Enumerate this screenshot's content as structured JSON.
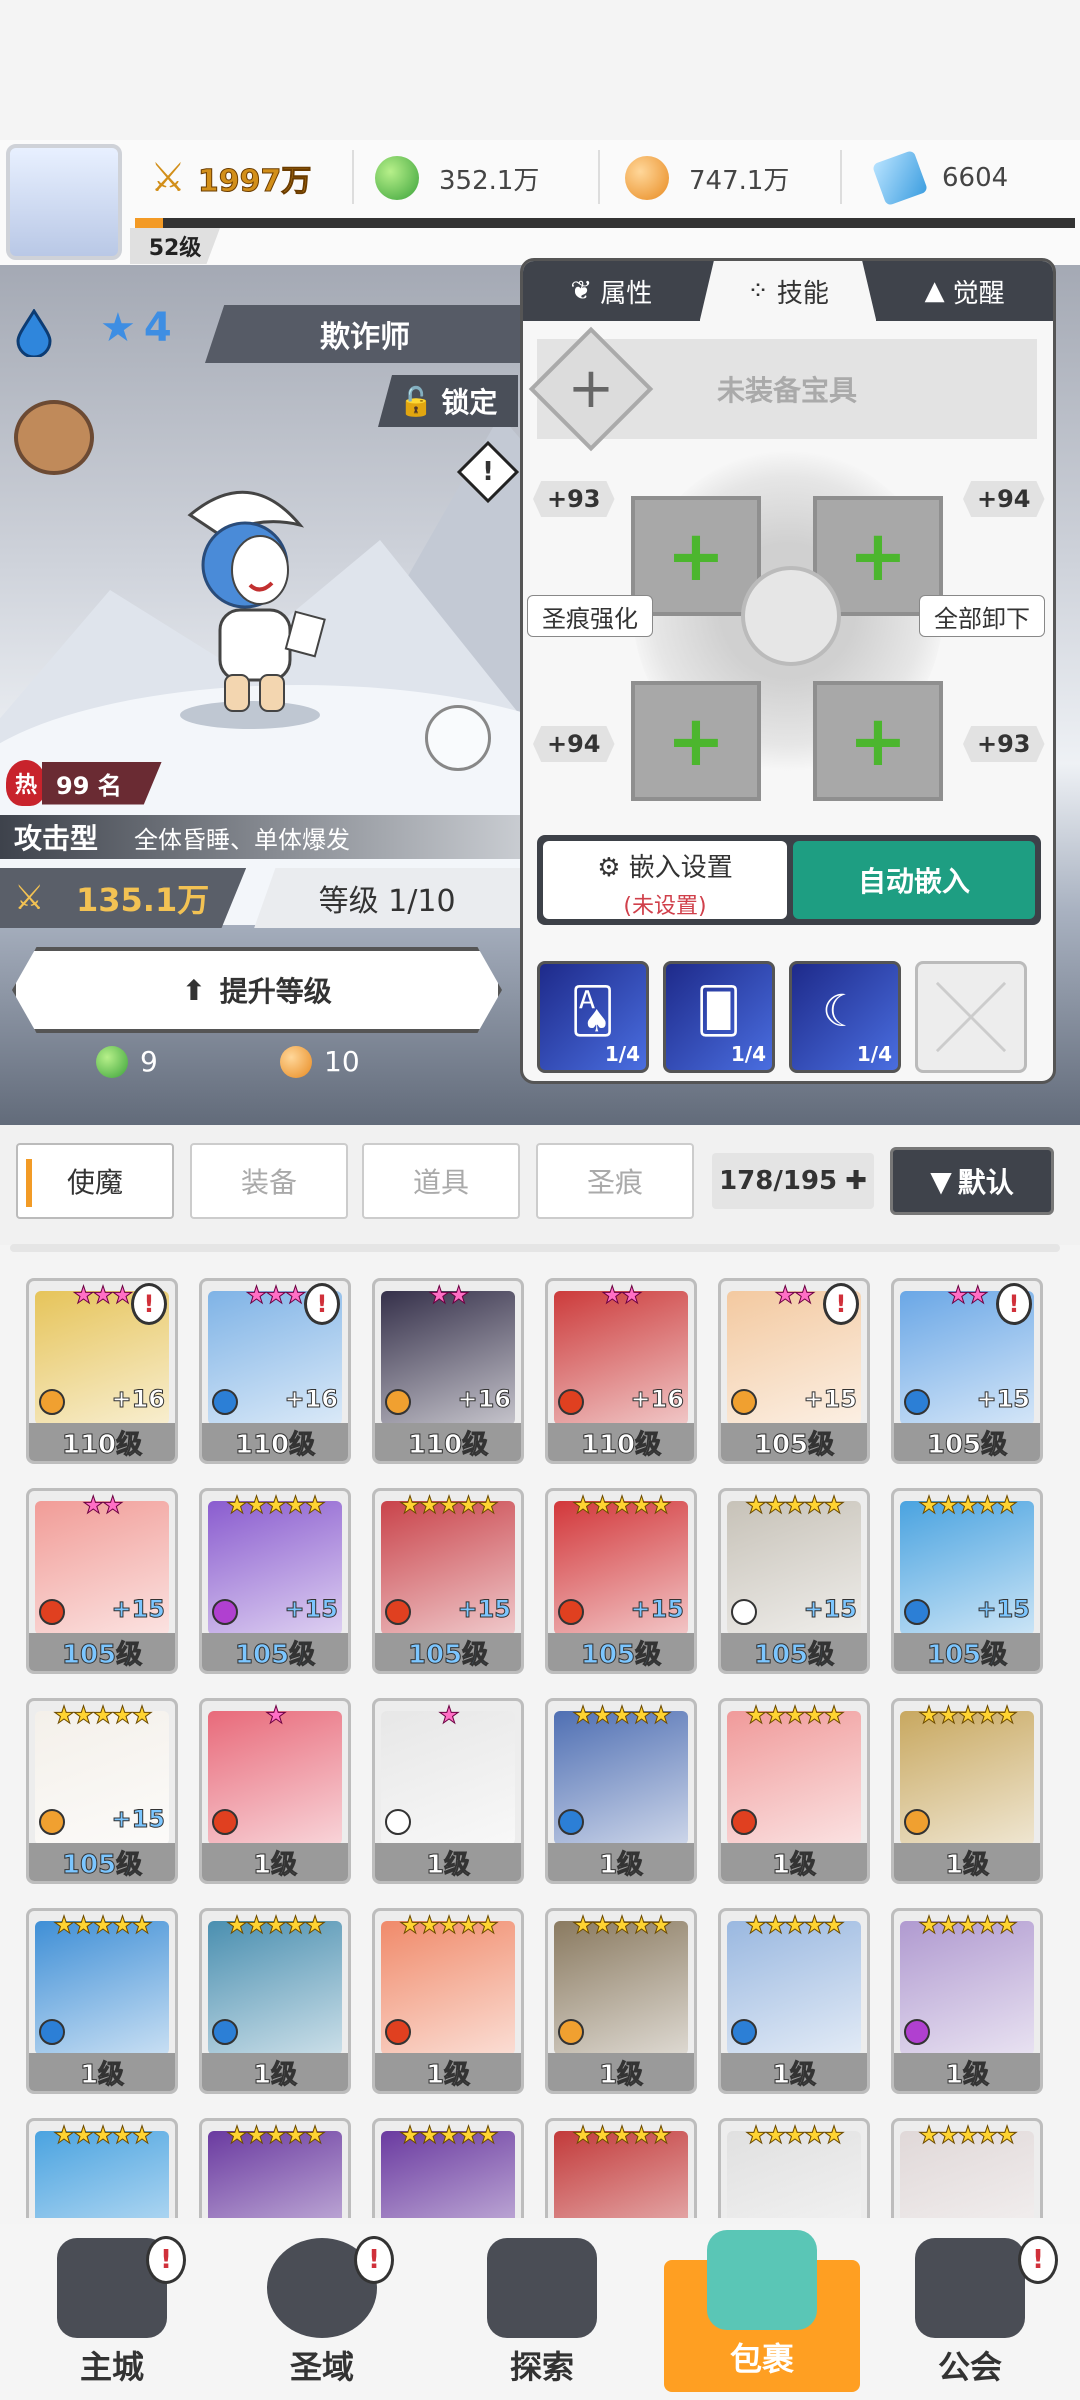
{
  "top": {
    "power": "1997万",
    "green_gem": "352.1万",
    "gold": "747.1万",
    "diamond": "6604",
    "player_level": "52级",
    "xp_fraction": 0.03
  },
  "hero": {
    "name": "欺诈师",
    "stars": "4",
    "lock_label": "锁定",
    "hot_icon": "热",
    "hot_rank": "99 名",
    "type": "攻击型",
    "type_desc": "全体昏睡、单体爆发",
    "power": "135.1万",
    "level": "等级 1/10",
    "upgrade_label": "提升等级",
    "cost_green": "9",
    "cost_gold": "10",
    "warn": "!"
  },
  "panel": {
    "tabs": [
      "属性",
      "技能",
      "觉醒"
    ],
    "active_tab": 1,
    "equip_empty": "未装备宝具",
    "rune_values": {
      "tl": "+93",
      "tr": "+94",
      "bl": "+94",
      "br": "+93"
    },
    "left_side": "圣痕强化",
    "right_side": "全部卸下",
    "embed_setting": "嵌入设置",
    "embed_unset": "(未设置)",
    "auto_embed": "自动嵌入",
    "skills": [
      "1/4",
      "1/4",
      "1/4"
    ]
  },
  "inventory": {
    "tabs": [
      "使魔",
      "装备",
      "道具",
      "圣痕"
    ],
    "count": "178/195",
    "sort": "默认"
  },
  "cards": [
    {
      "stars": "★★★",
      "pink": true,
      "plus": "+16",
      "level": "110级",
      "alert": true,
      "color": "#e6c45a",
      "el": "#f0a030"
    },
    {
      "stars": "★★★",
      "pink": true,
      "plus": "+16",
      "level": "110级",
      "alert": true,
      "color": "#7fb3e6",
      "el": "#2c7fd6"
    },
    {
      "stars": "★★",
      "pink": true,
      "plus": "+16",
      "level": "110级",
      "alert": false,
      "color": "#35304a",
      "el": "#f0a030"
    },
    {
      "stars": "★★",
      "pink": true,
      "plus": "+16",
      "level": "110级",
      "alert": false,
      "color": "#cc3b3b",
      "el": "#e04020"
    },
    {
      "stars": "★★",
      "pink": true,
      "plus": "+15",
      "level": "105级",
      "alert": true,
      "color": "#f3c9a0",
      "el": "#f0a030"
    },
    {
      "stars": "★★",
      "pink": true,
      "plus": "+15",
      "level": "105级",
      "alert": true,
      "color": "#6aa7e6",
      "el": "#2c7fd6"
    },
    {
      "stars": "★★",
      "pink": true,
      "plus": "+15",
      "level": "105级",
      "blue": true,
      "alert": false,
      "color": "#f19c97",
      "el": "#e04020"
    },
    {
      "stars": "★★★★★",
      "pink": false,
      "plus": "+15",
      "level": "105级",
      "blue": true,
      "alert": false,
      "color": "#8a5ccf",
      "el": "#b040d0"
    },
    {
      "stars": "★★★★★",
      "pink": false,
      "plus": "+15",
      "level": "105级",
      "blue": true,
      "alert": false,
      "color": "#c9434a",
      "el": "#e04020"
    },
    {
      "stars": "★★★★★",
      "pink": false,
      "plus": "+15",
      "level": "105级",
      "blue": true,
      "alert": false,
      "color": "#d2373a",
      "el": "#e04020"
    },
    {
      "stars": "★★★★★",
      "pink": false,
      "plus": "+15",
      "level": "105级",
      "blue": true,
      "alert": false,
      "color": "#c7c2b8",
      "el": "#ffffff"
    },
    {
      "stars": "★★★★★",
      "pink": false,
      "plus": "+15",
      "level": "105级",
      "blue": true,
      "alert": false,
      "color": "#4aa3e0",
      "el": "#2c7fd6"
    },
    {
      "stars": "★★★★★",
      "pink": false,
      "plus": "+15",
      "level": "105级",
      "blue": true,
      "alert": false,
      "color": "#f4f0ea",
      "el": "#f0a030"
    },
    {
      "stars": "★",
      "pink": true,
      "plus": "",
      "level": "1级",
      "alert": false,
      "color": "#e86a7a",
      "el": "#e04020"
    },
    {
      "stars": "★",
      "pink": true,
      "plus": "",
      "level": "1级",
      "alert": false,
      "color": "#e7e7e7",
      "el": "#ffffff"
    },
    {
      "stars": "★★★★★",
      "pink": false,
      "plus": "",
      "level": "1级",
      "alert": false,
      "color": "#4f6fb3",
      "el": "#2c7fd6"
    },
    {
      "stars": "★★★★★",
      "pink": false,
      "plus": "",
      "level": "1级",
      "alert": false,
      "color": "#f09a9a",
      "el": "#e04020"
    },
    {
      "stars": "★★★★★",
      "pink": false,
      "plus": "",
      "level": "1级",
      "alert": false,
      "color": "#c8a860",
      "el": "#f0a030"
    },
    {
      "stars": "★★★★★",
      "pink": false,
      "plus": "",
      "level": "1级",
      "alert": false,
      "color": "#3f8fd6",
      "el": "#2c7fd6"
    },
    {
      "stars": "★★★★★",
      "pink": false,
      "plus": "",
      "level": "1级",
      "alert": false,
      "color": "#4a8fb0",
      "el": "#2c7fd6"
    },
    {
      "stars": "★★★★★",
      "pink": false,
      "plus": "",
      "level": "1级",
      "alert": false,
      "color": "#f08a6a",
      "el": "#e04020"
    },
    {
      "stars": "★★★★★",
      "pink": false,
      "plus": "",
      "level": "1级",
      "alert": false,
      "color": "#8a7a60",
      "el": "#f0a030"
    },
    {
      "stars": "★★★★★",
      "pink": false,
      "plus": "",
      "level": "1级",
      "alert": false,
      "color": "#9ab8e0",
      "el": "#2c7fd6"
    },
    {
      "stars": "★★★★★",
      "pink": false,
      "plus": "",
      "level": "1级",
      "alert": false,
      "color": "#b09ad0",
      "el": "#b040d0"
    },
    {
      "stars": "★★★★★",
      "pink": false,
      "plus": "",
      "level": "",
      "alert": false,
      "color": "#4aa3e0",
      "el": ""
    },
    {
      "stars": "★★★★★",
      "pink": false,
      "plus": "",
      "level": "",
      "alert": false,
      "color": "#6a3aa0",
      "el": ""
    },
    {
      "stars": "★★★★★",
      "pink": false,
      "plus": "",
      "level": "",
      "alert": false,
      "color": "#6a3aa0",
      "el": ""
    },
    {
      "stars": "★★★★★",
      "pink": false,
      "plus": "",
      "level": "",
      "alert": false,
      "color": "#c23a3a",
      "el": ""
    },
    {
      "stars": "★★★★★",
      "pink": false,
      "plus": "",
      "level": "",
      "alert": false,
      "color": "#e0e0e0",
      "el": ""
    },
    {
      "stars": "★★★★★",
      "pink": false,
      "plus": "",
      "level": "",
      "alert": false,
      "color": "#e0d8d8",
      "el": ""
    }
  ],
  "nav": [
    {
      "label": "主城",
      "alert": true
    },
    {
      "label": "圣域",
      "alert": true
    },
    {
      "label": "探索",
      "alert": false
    },
    {
      "label": "包裹",
      "alert": false,
      "active": true
    },
    {
      "label": "公会",
      "alert": true
    }
  ]
}
